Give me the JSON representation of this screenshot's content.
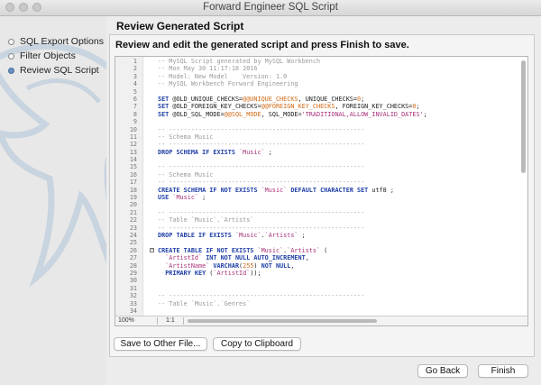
{
  "window": {
    "title": "Forward Engineer SQL Script"
  },
  "sidebar": {
    "steps": [
      {
        "label": "SQL Export Options",
        "active": false
      },
      {
        "label": "Filter Objects",
        "active": false
      },
      {
        "label": "Review SQL Script",
        "active": true
      }
    ]
  },
  "main": {
    "section_title": "Review Generated Script",
    "instruction": "Review and edit the generated script and press Finish to save.",
    "editor": {
      "lines": [
        {
          "n": "1",
          "segs": [
            [
              "c",
              "-- MySQL Script generated by MySQL Workbench"
            ]
          ]
        },
        {
          "n": "2",
          "segs": [
            [
              "c",
              "-- Mon May 30 11:17:18 2016"
            ]
          ]
        },
        {
          "n": "3",
          "segs": [
            [
              "c",
              "-- Model: New Model    Version: 1.0"
            ]
          ]
        },
        {
          "n": "4",
          "segs": [
            [
              "c",
              "-- MySQL Workbench Forward Engineering"
            ]
          ]
        },
        {
          "n": "5",
          "segs": []
        },
        {
          "n": "6",
          "segs": [
            [
              "k",
              "SET"
            ],
            [
              "p",
              " @OLD_UNIQUE_CHECKS="
            ],
            [
              "v",
              "@@UNIQUE_CHECKS"
            ],
            [
              "p",
              ", UNIQUE_CHECKS="
            ],
            [
              "v",
              "0"
            ],
            [
              "p",
              ";"
            ]
          ]
        },
        {
          "n": "7",
          "segs": [
            [
              "k",
              "SET"
            ],
            [
              "p",
              " @OLD_FOREIGN_KEY_CHECKS="
            ],
            [
              "v",
              "@@FOREIGN_KEY_CHECKS"
            ],
            [
              "p",
              ", FOREIGN_KEY_CHECKS="
            ],
            [
              "v",
              "0"
            ],
            [
              "p",
              ";"
            ]
          ]
        },
        {
          "n": "8",
          "segs": [
            [
              "k",
              "SET"
            ],
            [
              "p",
              " @OLD_SQL_MODE="
            ],
            [
              "v",
              "@@SQL_MODE"
            ],
            [
              "p",
              ", SQL_MODE="
            ],
            [
              "s",
              "'TRADITIONAL,ALLOW_INVALID_DATES'"
            ],
            [
              "p",
              ";"
            ]
          ]
        },
        {
          "n": "9",
          "segs": []
        },
        {
          "n": "10",
          "segs": [
            [
              "c",
              "-- -----------------------------------------------------"
            ]
          ]
        },
        {
          "n": "11",
          "segs": [
            [
              "c",
              "-- Schema Music"
            ]
          ]
        },
        {
          "n": "12",
          "segs": [
            [
              "c",
              "-- -----------------------------------------------------"
            ]
          ]
        },
        {
          "n": "13",
          "segs": [
            [
              "k",
              "DROP SCHEMA IF EXISTS"
            ],
            [
              "p",
              " "
            ],
            [
              "s",
              "`Music`"
            ],
            [
              "p",
              " ;"
            ]
          ]
        },
        {
          "n": "14",
          "segs": []
        },
        {
          "n": "15",
          "segs": [
            [
              "c",
              "-- -----------------------------------------------------"
            ]
          ]
        },
        {
          "n": "16",
          "segs": [
            [
              "c",
              "-- Schema Music"
            ]
          ]
        },
        {
          "n": "17",
          "segs": [
            [
              "c",
              "-- -----------------------------------------------------"
            ]
          ]
        },
        {
          "n": "18",
          "segs": [
            [
              "k",
              "CREATE SCHEMA IF NOT EXISTS"
            ],
            [
              "p",
              " "
            ],
            [
              "s",
              "`Music`"
            ],
            [
              "p",
              " "
            ],
            [
              "k",
              "DEFAULT CHARACTER SET"
            ],
            [
              "p",
              " utf8 ;"
            ]
          ]
        },
        {
          "n": "19",
          "segs": [
            [
              "k",
              "USE"
            ],
            [
              "p",
              " "
            ],
            [
              "s",
              "`Music`"
            ],
            [
              "p",
              " ;"
            ]
          ]
        },
        {
          "n": "20",
          "segs": []
        },
        {
          "n": "21",
          "segs": [
            [
              "c",
              "-- -----------------------------------------------------"
            ]
          ]
        },
        {
          "n": "22",
          "segs": [
            [
              "c",
              "-- Table `Music`.`Artists`"
            ]
          ]
        },
        {
          "n": "23",
          "segs": [
            [
              "c",
              "-- -----------------------------------------------------"
            ]
          ]
        },
        {
          "n": "24",
          "segs": [
            [
              "k",
              "DROP TABLE IF EXISTS"
            ],
            [
              "p",
              " "
            ],
            [
              "s",
              "`Music`"
            ],
            [
              "p",
              "."
            ],
            [
              "s",
              "`Artists`"
            ],
            [
              "p",
              " ;"
            ]
          ]
        },
        {
          "n": "25",
          "segs": []
        },
        {
          "n": "26",
          "fold": true,
          "segs": [
            [
              "k",
              "CREATE TABLE IF NOT EXISTS"
            ],
            [
              "p",
              " "
            ],
            [
              "s",
              "`Music`"
            ],
            [
              "p",
              "."
            ],
            [
              "s",
              "`Artists`"
            ],
            [
              "p",
              " ("
            ]
          ]
        },
        {
          "n": "27",
          "segs": [
            [
              "p",
              "  "
            ],
            [
              "s",
              "`ArtistId`"
            ],
            [
              "p",
              " "
            ],
            [
              "k",
              "INT NOT NULL AUTO_INCREMENT"
            ],
            [
              "p",
              ","
            ]
          ]
        },
        {
          "n": "28",
          "segs": [
            [
              "p",
              "  "
            ],
            [
              "s",
              "`ArtistName`"
            ],
            [
              "p",
              " "
            ],
            [
              "k",
              "VARCHAR"
            ],
            [
              "p",
              "("
            ],
            [
              "v",
              "255"
            ],
            [
              "p",
              ") "
            ],
            [
              "k",
              "NOT NULL"
            ],
            [
              "p",
              ","
            ]
          ]
        },
        {
          "n": "29",
          "segs": [
            [
              "p",
              "  "
            ],
            [
              "k",
              "PRIMARY KEY"
            ],
            [
              "p",
              " ("
            ],
            [
              "s",
              "`ArtistId`"
            ],
            [
              "p",
              "));"
            ]
          ]
        },
        {
          "n": "30",
          "segs": []
        },
        {
          "n": "31",
          "segs": []
        },
        {
          "n": "32",
          "segs": [
            [
              "c",
              "-- -----------------------------------------------------"
            ]
          ]
        },
        {
          "n": "33",
          "segs": [
            [
              "c",
              "-- Table `Music`.`Genres`"
            ]
          ]
        },
        {
          "n": "34",
          "segs": []
        }
      ],
      "zoom": "100%",
      "position": "1:1"
    },
    "buttons": {
      "save_to_file": "Save to Other File...",
      "copy_clipboard": "Copy to Clipboard"
    }
  },
  "footer": {
    "go_back": "Go Back",
    "finish": "Finish"
  },
  "colors": {
    "keyword": "#1f3fa8",
    "comment": "#9a9a9a",
    "string": "#a8327a",
    "variable": "#d06a16"
  }
}
